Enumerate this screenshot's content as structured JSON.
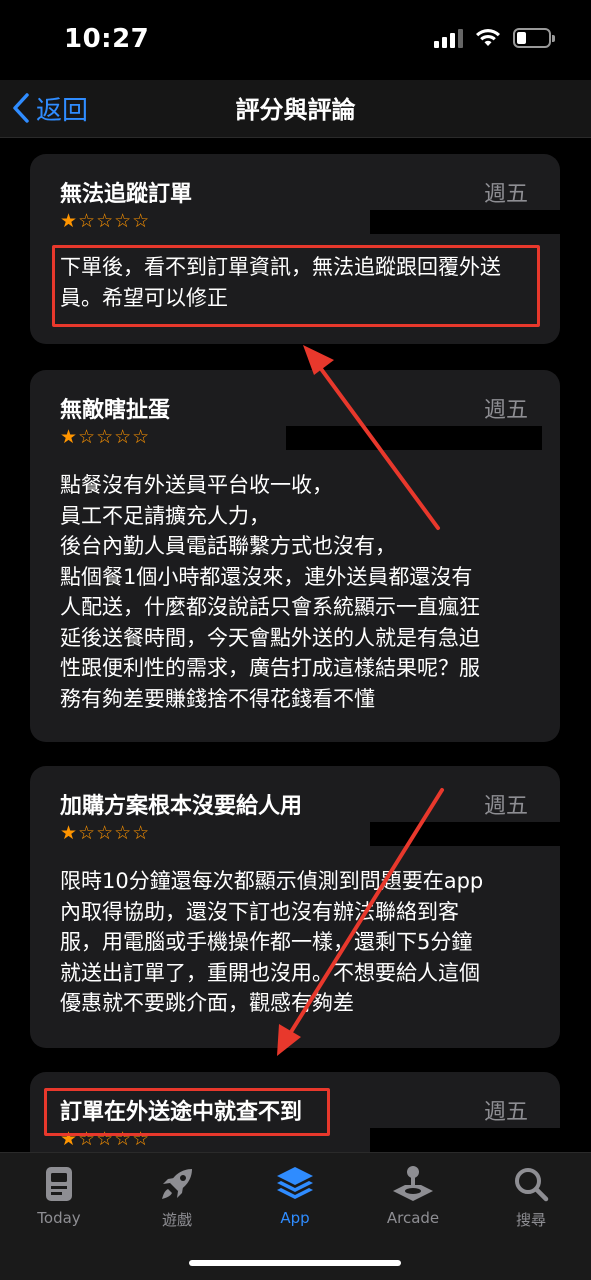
{
  "status": {
    "time": "10:27"
  },
  "nav": {
    "back_label": "返回",
    "title": "評分與評論"
  },
  "reviews": [
    {
      "title": "無法追蹤訂單",
      "date": "週五",
      "rating": 1,
      "body": "下單後，看不到訂單資訊，無法追蹤跟回覆外送員。希望可以修正"
    },
    {
      "title": "無敵瞎扯蛋",
      "date": "週五",
      "rating": 1,
      "body_lines": [
        "點餐沒有外送員平台收一收，",
        "員工不足請擴充人力，",
        "後台內勤人員電話聯繫方式也沒有，",
        "點個餐1個小時都還沒來，連外送員都還沒有",
        "人配送，什麼都沒說話只會系統顯示一直瘋狂",
        "延後送餐時間，今天會點外送的人就是有急迫",
        "性跟便利性的需求，廣告打成這樣結果呢？服",
        "務有夠差要賺錢捨不得花錢看不懂"
      ]
    },
    {
      "title": "加購方案根本沒要給人用",
      "date": "週五",
      "rating": 1,
      "body_lines": [
        "限時10分鐘還每次都顯示偵測到問題要在app",
        "內取得協助，還沒下訂也沒有辦法聯絡到客",
        "服，用電腦或手機操作都一樣，還剩下5分鐘",
        "就送出訂單了，重開也沒用。不想要給人這個",
        "優惠就不要跳介面，觀感有夠差"
      ]
    },
    {
      "title": "訂單在外送途中就查不到",
      "date": "週五",
      "rating": 1
    }
  ],
  "tabs": [
    {
      "label": "Today",
      "icon": "today-icon",
      "active": false
    },
    {
      "label": "遊戲",
      "icon": "rocket-icon",
      "active": false
    },
    {
      "label": "App",
      "icon": "layers-icon",
      "active": true
    },
    {
      "label": "Arcade",
      "icon": "joystick-icon",
      "active": false
    },
    {
      "label": "搜尋",
      "icon": "search-icon",
      "active": false
    }
  ],
  "colors": {
    "accent": "#2f8cff",
    "star": "#ff9500",
    "annotation": "#e8382c",
    "card": "#1c1c1e"
  }
}
